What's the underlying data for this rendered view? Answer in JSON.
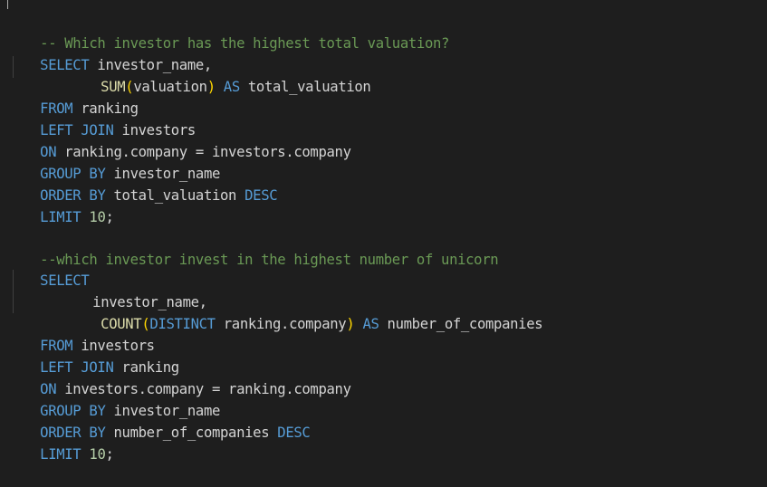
{
  "colors": {
    "background": "#1e1e1e",
    "keyword": "#569cd6",
    "function": "#dcdcaa",
    "comment": "#6a9955",
    "number": "#b5cea8",
    "text": "#d4d4d4",
    "bracket": "#ffd700"
  },
  "q1": {
    "comment": "-- Which investor has the highest total valuation?",
    "select_kw": "SELECT",
    "l2_rest": " investor_name,",
    "sum_fn": "SUM",
    "sum_arg": "valuation",
    "as_kw": "AS",
    "alias": " total_valuation",
    "from_kw": "FROM",
    "from_rest": " ranking",
    "left_kw": "LEFT",
    "join_kw": "JOIN",
    "join_rest": " investors",
    "on_kw": "ON",
    "on_rest": " ranking.company = investors.company",
    "group_kw": "GROUP",
    "by_kw": "BY",
    "group_rest": " investor_name",
    "order_kw": "ORDER",
    "order_by_kw": "BY",
    "order_rest": " total_valuation ",
    "desc_kw": "DESC",
    "limit_kw": "LIMIT",
    "limit_num": "10",
    "semi": ";"
  },
  "q2": {
    "comment": "--which investor invest in the highest number of unicorn",
    "select_kw": "SELECT",
    "l12_text": "investor_name,",
    "count_fn": "COUNT",
    "distinct_kw": "DISTINCT",
    "count_arg": " ranking.company",
    "as_kw": "AS",
    "alias": " number_of_companies",
    "from_kw": "FROM",
    "from_rest": " investors",
    "left_kw": "LEFT",
    "join_kw": "JOIN",
    "join_rest": " ranking",
    "on_kw": "ON",
    "on_rest": " investors.company = ranking.company",
    "group_kw": "GROUP",
    "by_kw": "BY",
    "group_rest": " investor_name",
    "order_kw": "ORDER",
    "order_by_kw": "BY",
    "order_rest": " number_of_companies ",
    "desc_kw": "DESC",
    "limit_kw": "LIMIT",
    "limit_num": "10",
    "semi": ";"
  }
}
